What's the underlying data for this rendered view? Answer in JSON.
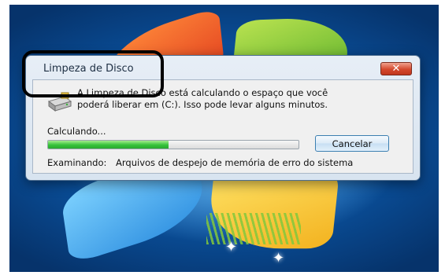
{
  "dialog": {
    "title": "Limpeza de Disco",
    "close_label": "✕",
    "message_line1": "A Limpeza de Disco está calculando o espaço que você",
    "message_line2": "poderá liberar em  (C:). Isso pode levar alguns minutos.",
    "status_label": "Calculando...",
    "progress_fraction": 0.48,
    "cancel_label": "Cancelar",
    "examining_label": "Examinando:",
    "examining_item": "Arquivos de despejo de memória de erro do sistema"
  },
  "icons": {
    "disk": "disk-drive-icon",
    "close": "close-icon"
  },
  "colors": {
    "progress": "#35c23a",
    "close_button": "#d4482d",
    "annotation": "#000000"
  }
}
